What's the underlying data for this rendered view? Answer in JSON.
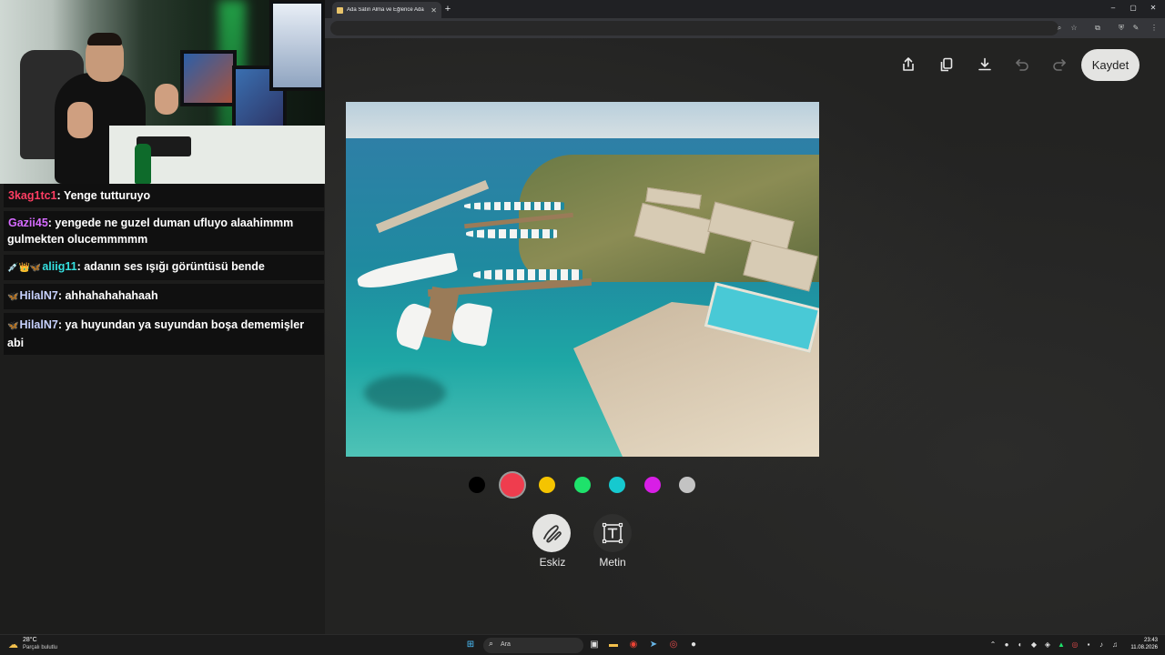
{
  "browser": {
    "tab_title": "Ada Satın Alma ve Eğlence Ada",
    "new_tab": "+",
    "window_controls": [
      "–",
      "▢",
      "✕"
    ]
  },
  "chat": {
    "messages": [
      {
        "user": "3kag1tc1",
        "user_color": "#ff3e63",
        "text": "Yenge tutturuyo",
        "badges": ""
      },
      {
        "user": "Gazii45",
        "user_color": "#d66bff",
        "text": "yengede ne guzel duman ufluyo alaahimmm gulmekten olucemmmmm",
        "badges": ""
      },
      {
        "user": "aliig11",
        "user_color": "#35e0e0",
        "text": "adanın ses ışığı görüntüsü bende",
        "badges": "💉👑🦋"
      },
      {
        "user": "HilalN7",
        "user_color": "#c8d2ff",
        "text": "ahhahahahahaah",
        "badges": "🦋"
      },
      {
        "user": "HilalN7",
        "user_color": "#c8d2ff",
        "text": "ya huyundan ya suyundan boşa dememişler abi",
        "badges": "🦋"
      }
    ]
  },
  "editor": {
    "toolbar": {
      "share_icon": "share-icon",
      "copy_icon": "copy-icon",
      "download_icon": "download-icon",
      "undo_icon": "undo-icon",
      "redo_icon": "redo-icon",
      "save_label": "Kaydet"
    },
    "palette": [
      {
        "name": "black",
        "color": "#000000",
        "selected": false
      },
      {
        "name": "red",
        "color": "#ef3d4e",
        "selected": true
      },
      {
        "name": "yellow",
        "color": "#f5c400",
        "selected": false
      },
      {
        "name": "green",
        "color": "#1ee26b",
        "selected": false
      },
      {
        "name": "cyan",
        "color": "#16c9cf",
        "selected": false
      },
      {
        "name": "magenta",
        "color": "#d81ee6",
        "selected": false
      },
      {
        "name": "gray",
        "color": "#c3c3c3",
        "selected": false
      }
    ],
    "modes": {
      "sketch_label": "Eskiz",
      "text_label": "Metin",
      "selected": "Eskiz"
    }
  },
  "taskbar": {
    "weather_temp": "28°C",
    "weather_condition": "Parçalı bulutlu",
    "search_placeholder": "Ara",
    "time": "23:43",
    "date": "11.08.2026"
  },
  "colors": {
    "editor_bg": "#232322",
    "save_button_bg": "#e4e4e2",
    "chat_bg": "#0e0e0e"
  }
}
